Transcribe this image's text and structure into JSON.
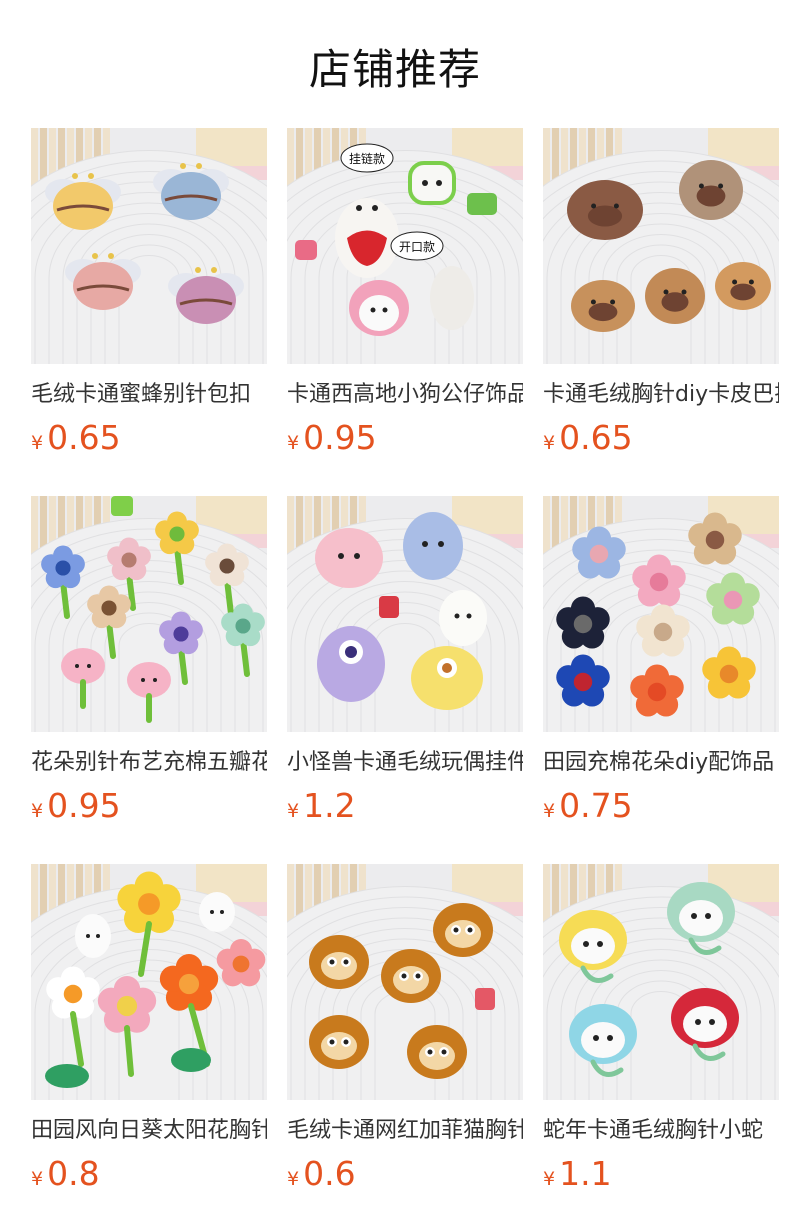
{
  "section": {
    "title": "店铺推荐"
  },
  "products": [
    {
      "name": "毛绒卡通蜜蜂别针包扣",
      "currency": "¥",
      "price": "0.65",
      "theme": "bees",
      "badges": []
    },
    {
      "name": "卡通西高地小狗公仔饰品",
      "currency": "¥",
      "price": "0.95",
      "theme": "dogs",
      "badges": [
        "挂链款",
        "开口款"
      ]
    },
    {
      "name": "卡通毛绒胸针diy卡皮巴拉",
      "currency": "¥",
      "price": "0.65",
      "theme": "capybara",
      "badges": []
    },
    {
      "name": "花朵别针布艺充棉五瓣花",
      "currency": "¥",
      "price": "0.95",
      "theme": "flowers-mixed",
      "badges": []
    },
    {
      "name": "小怪兽卡通毛绒玩偶挂件",
      "currency": "¥",
      "price": "1.2",
      "theme": "monsters",
      "badges": []
    },
    {
      "name": "田园充棉花朵diy配饰品",
      "currency": "¥",
      "price": "0.75",
      "theme": "flowers-color",
      "badges": []
    },
    {
      "name": "田园风向日葵太阳花胸针",
      "currency": "¥",
      "price": "0.8",
      "theme": "sunflower",
      "badges": []
    },
    {
      "name": "毛绒卡通网红加菲猫胸针",
      "currency": "¥",
      "price": "0.6",
      "theme": "garfield",
      "badges": []
    },
    {
      "name": "蛇年卡通毛绒胸针小蛇",
      "currency": "¥",
      "price": "1.1",
      "theme": "snake",
      "badges": []
    }
  ],
  "colors": {
    "price": "#e4521f",
    "text": "#333333",
    "title": "#111111"
  }
}
